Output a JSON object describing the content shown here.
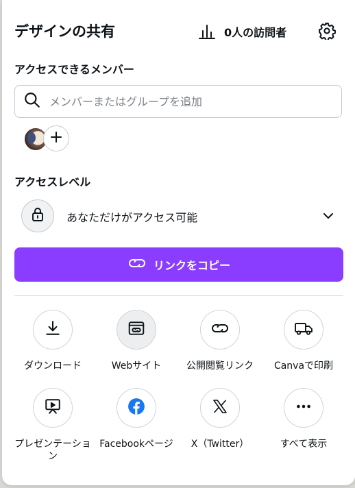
{
  "header": {
    "title": "デザインの共有",
    "visitors_text": "0人の訪問者"
  },
  "members": {
    "label": "アクセスできるメンバー",
    "search_placeholder": "メンバーまたはグループを追加",
    "search_value": ""
  },
  "access": {
    "label": "アクセスレベル",
    "current": "あなただけがアクセス可能"
  },
  "copy_link": {
    "label": "リンクをコピー"
  },
  "share_options": [
    {
      "label": "ダウンロード",
      "icon": "download-icon"
    },
    {
      "label": "Webサイト",
      "icon": "website-icon"
    },
    {
      "label": "公開閲覧リンク",
      "icon": "link-icon"
    },
    {
      "label": "Canvaで印刷",
      "icon": "truck-icon"
    },
    {
      "label": "プレゼンテーション",
      "icon": "presentation-icon"
    },
    {
      "label": "Facebookページ",
      "icon": "facebook-icon"
    },
    {
      "label": "X（Twitter）",
      "icon": "x-twitter-icon"
    },
    {
      "label": "すべて表示",
      "icon": "more-icon"
    }
  ],
  "colors": {
    "accent": "#8b3dff",
    "facebook": "#1877f2",
    "text": "#0d1216",
    "border": "#c6c9cd"
  }
}
